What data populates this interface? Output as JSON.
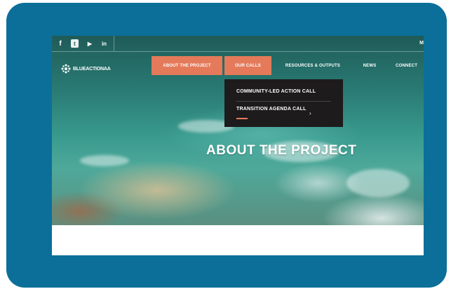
{
  "social": {
    "icons": [
      "facebook-icon",
      "twitter-icon",
      "youtube-icon",
      "linkedin-icon"
    ],
    "glyphs": [
      "f",
      "t",
      "▶",
      "in"
    ]
  },
  "topbar": {
    "right_text": "M"
  },
  "logo": {
    "text": "BLUEACTIONAA"
  },
  "nav": {
    "items": [
      {
        "label": "ABOUT THE PROJECT",
        "active": true
      },
      {
        "label": "OUR CALLS",
        "active": true
      },
      {
        "label": "RESOURCES & OUTPUTS",
        "active": false
      },
      {
        "label": "NEWS",
        "active": false
      },
      {
        "label": "CONNECT",
        "active": false
      }
    ]
  },
  "dropdown": {
    "items": [
      {
        "label": "COMMUNITY-LED ACTION CALL"
      },
      {
        "label": "TRANSITION AGENDA CALL"
      }
    ]
  },
  "hero": {
    "title": "ABOUT THE PROJECT"
  },
  "colors": {
    "accent": "#e47a5a",
    "frame": "#0b6f99",
    "dropdown_bg": "#1d1b1c"
  }
}
